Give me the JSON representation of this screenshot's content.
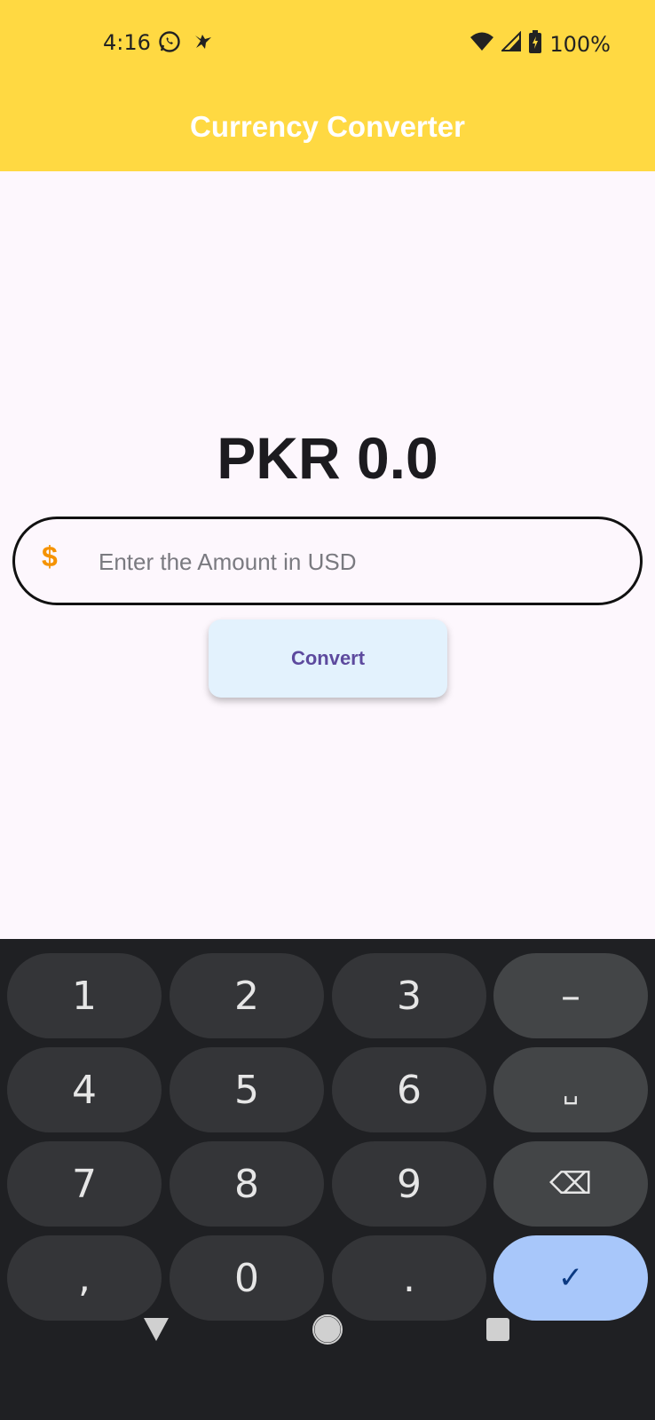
{
  "status_bar": {
    "time": "4:16",
    "battery": "100%",
    "icons": [
      "whatsapp-icon",
      "notification-icon",
      "wifi-icon",
      "signal-icon",
      "battery-charging-icon"
    ]
  },
  "app_bar": {
    "title": "Currency Converter",
    "color": "#ffd942"
  },
  "result": {
    "text": "PKR 0.0"
  },
  "amount_field": {
    "prefix_icon": "dollar-icon",
    "prefix_symbol": "$",
    "placeholder": "Enter the Amount in USD",
    "value": ""
  },
  "convert_button": {
    "label": "Convert"
  },
  "keyboard": {
    "keys": [
      {
        "label": "1"
      },
      {
        "label": "2"
      },
      {
        "label": "3"
      },
      {
        "label": "–"
      },
      {
        "label": "4"
      },
      {
        "label": "5"
      },
      {
        "label": "6"
      },
      {
        "label": "␣"
      },
      {
        "label": "7"
      },
      {
        "label": "8"
      },
      {
        "label": "9"
      },
      {
        "label": "⌫"
      },
      {
        "label": ","
      },
      {
        "label": "0"
      },
      {
        "label": "."
      },
      {
        "label": "✓"
      }
    ]
  },
  "nav_bar": {
    "icons": [
      "back-icon",
      "home-icon",
      "recents-icon"
    ]
  }
}
